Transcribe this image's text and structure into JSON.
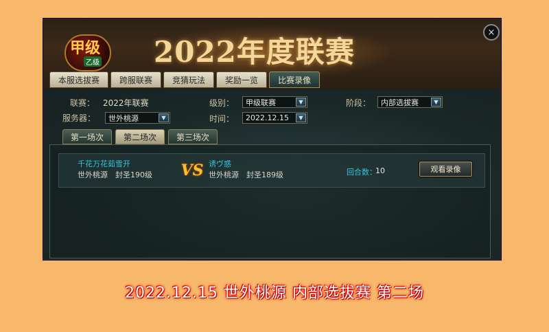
{
  "banner": {
    "logo_text": "甲级",
    "logo_sub": "乙级",
    "title": "2022年度联赛"
  },
  "close_label": "×",
  "main_tabs": [
    {
      "label": "本服选拔赛",
      "active": false
    },
    {
      "label": "跨服联赛",
      "active": false
    },
    {
      "label": "竞猜玩法",
      "active": false
    },
    {
      "label": "奖励一览",
      "active": false
    },
    {
      "label": "比赛录像",
      "active": true
    }
  ],
  "filters": {
    "league_label": "联赛：",
    "league_value": "2022年联赛",
    "level_label": "级别：",
    "level_value": "甲级联赛",
    "stage_label": "阶段：",
    "stage_value": "内部选拔赛",
    "server_label": "服务器：",
    "server_value": "世外桃源",
    "time_label": "时间：",
    "time_value": "2022.12.15"
  },
  "sub_tabs": [
    {
      "label": "第一场次",
      "active": false
    },
    {
      "label": "第二场次",
      "active": true
    },
    {
      "label": "第三场次",
      "active": false
    }
  ],
  "match": {
    "player1_name": "千花万花茹雪开",
    "player1_server": "世外桃源",
    "player1_rank": "封圣190级",
    "vs_label": "VS",
    "player2_name": "诱ヴ惑",
    "player2_server": "世外桃源",
    "player2_rank": "封圣189级",
    "rounds_label": "回合数：",
    "rounds_value": "10",
    "watch_button": "观看录像"
  },
  "caption": "2022.12.15 世外桃源 内部选拔赛 第二场",
  "colors": {
    "background": "#f7b86b",
    "player_name": "#35c6e0",
    "caption_glow": "#e00000"
  }
}
